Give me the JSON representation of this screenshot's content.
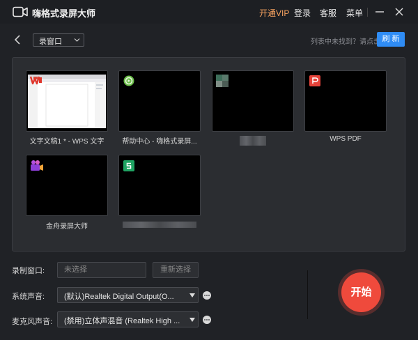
{
  "app": {
    "title": "嗨格式录屏大师",
    "vip_link": "开通VIP",
    "login_link": "登录",
    "service_link": "客服",
    "menu_link": "菜单"
  },
  "toolbar": {
    "mode_select": "录窗口",
    "not_found_text": "列表中未找到？请点击",
    "refresh_label": "刷 新"
  },
  "windows": [
    {
      "label": "文字文稿1 * - WPS 文字",
      "icon": "wps-writer-icon"
    },
    {
      "label": "帮助中心 - 嗨格式录屏...",
      "icon": "help-center-icon"
    },
    {
      "label": "",
      "icon": "blurred-app-icon"
    },
    {
      "label": "WPS PDF",
      "icon": "wps-pdf-icon"
    },
    {
      "label": "金舟录屏大师",
      "icon": "camera-app-icon"
    },
    {
      "label": "",
      "icon": "spreadsheet-s-icon"
    }
  ],
  "controls": {
    "record_window_label": "录制窗口:",
    "record_window_placeholder": "未选择",
    "reselect_label": "重新选择",
    "system_audio_label": "系统声音:",
    "system_audio_value": "(默认)Realtek Digital Output(O...",
    "mic_label": "麦克风声音:",
    "mic_value": "(禁用)立体声混音 (Realtek High ..."
  },
  "start_label": "开始",
  "colors": {
    "accent_vip": "#f5a15f",
    "refresh_blue": "#2f8cf4",
    "start_red": "#ef4a3c"
  }
}
